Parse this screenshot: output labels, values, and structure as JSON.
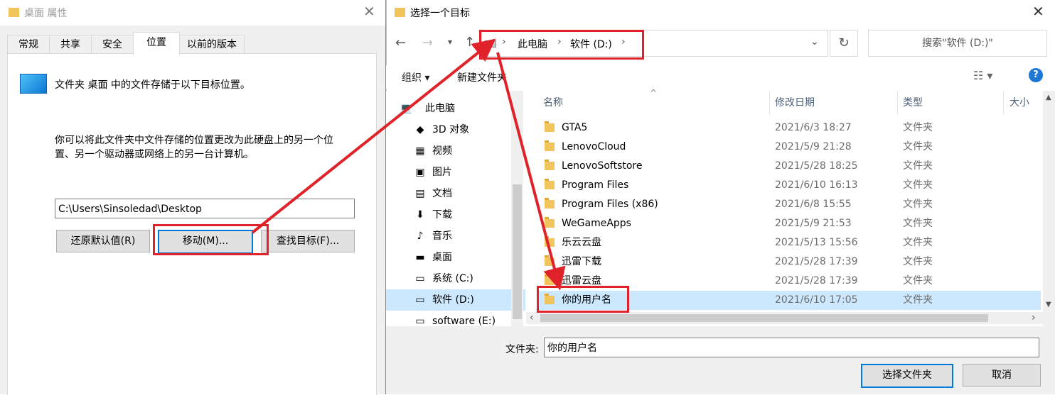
{
  "props": {
    "title": "桌面 属性",
    "tabs": [
      "常规",
      "共享",
      "安全",
      "位置",
      "以前的版本"
    ],
    "active_tab": "位置",
    "desc": "文件夹 桌面 中的文件存储于以下目标位置。",
    "info_line1": "你可以将此文件夹中文件存储的位置更改为此硬盘上的另一个位",
    "info_line2": "置、另一个驱动器或网络上的另一台计算机。",
    "path_value": "C:\\Users\\Sinsoledad\\Desktop",
    "restore_label": "还原默认值(R)",
    "move_label": "移动(M)...",
    "find_label": "查找目标(F)..."
  },
  "picker": {
    "title": "选择一个目标",
    "breadcrumb": [
      "此电脑",
      "软件 (D:)"
    ],
    "search_placeholder": "搜索\"软件 (D:)\"",
    "organize_label": "组织 ▾",
    "new_folder_label": "新建文件夹",
    "help_label": "?",
    "columns": {
      "name": "名称",
      "date": "修改日期",
      "type": "类型",
      "size": "大小"
    },
    "nav": [
      {
        "label": "此电脑",
        "icon": "computer-icon",
        "glyph": "💻"
      },
      {
        "label": "3D 对象",
        "icon": "3d-objects-icon",
        "glyph": "◆"
      },
      {
        "label": "视频",
        "icon": "video-icon",
        "glyph": "▦"
      },
      {
        "label": "图片",
        "icon": "pictures-icon",
        "glyph": "▣"
      },
      {
        "label": "文档",
        "icon": "documents-icon",
        "glyph": "▤"
      },
      {
        "label": "下载",
        "icon": "download-icon",
        "glyph": "⬇"
      },
      {
        "label": "音乐",
        "icon": "music-icon",
        "glyph": "♪"
      },
      {
        "label": "桌面",
        "icon": "desktop-icon",
        "glyph": "▬"
      },
      {
        "label": "系统 (C:)",
        "icon": "drive-icon",
        "glyph": "▭"
      },
      {
        "label": "软件 (D:)",
        "icon": "drive-icon",
        "glyph": "▭"
      },
      {
        "label": "software (E:)",
        "icon": "drive-icon",
        "glyph": "▭"
      }
    ],
    "selected_nav": "软件 (D:)",
    "files": [
      {
        "name": "GTA5",
        "date": "2021/6/3 18:27",
        "type": "文件夹"
      },
      {
        "name": "LenovoCloud",
        "date": "2021/5/9 21:28",
        "type": "文件夹"
      },
      {
        "name": "LenovoSoftstore",
        "date": "2021/5/28 18:25",
        "type": "文件夹"
      },
      {
        "name": "Program Files",
        "date": "2021/6/10 16:13",
        "type": "文件夹"
      },
      {
        "name": "Program Files (x86)",
        "date": "2021/6/8 15:55",
        "type": "文件夹"
      },
      {
        "name": "WeGameApps",
        "date": "2021/5/9 21:53",
        "type": "文件夹"
      },
      {
        "name": "乐云云盘",
        "date": "2021/5/13 15:56",
        "type": "文件夹"
      },
      {
        "name": "迅雷下载",
        "date": "2021/5/28 17:39",
        "type": "文件夹"
      },
      {
        "name": "迅雷云盘",
        "date": "2021/5/28 17:39",
        "type": "文件夹"
      },
      {
        "name": "你的用户名",
        "date": "2021/6/10 17:05",
        "type": "文件夹"
      }
    ],
    "selected_file": "你的用户名",
    "folder_label": "文件夹:",
    "folder_value": "你的用户名",
    "select_btn": "选择文件夹",
    "cancel_btn": "取消"
  },
  "annotation_color": "#e0232a"
}
